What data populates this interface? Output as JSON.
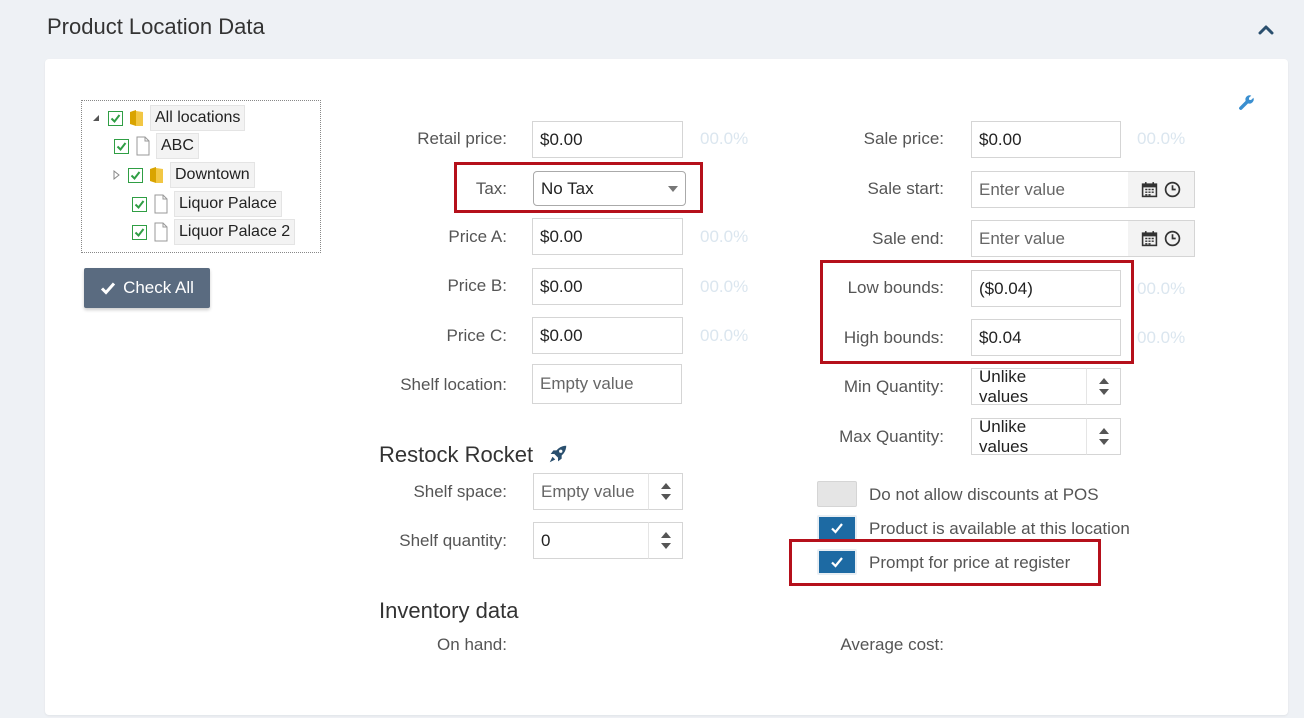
{
  "section": {
    "title": "Product Location Data"
  },
  "tree": {
    "nodes": [
      {
        "label": "All locations"
      },
      {
        "label": "ABC"
      },
      {
        "label": "Downtown"
      },
      {
        "label": "Liquor Palace"
      },
      {
        "label": "Liquor Palace 2"
      }
    ]
  },
  "check_all": {
    "label": "Check All"
  },
  "pricing": {
    "retail": {
      "label": "Retail price:",
      "value": "$0.00",
      "pct": "00.0%"
    },
    "tax": {
      "label": "Tax:",
      "value": "No Tax"
    },
    "price_a": {
      "label": "Price A:",
      "value": "$0.00",
      "pct": "00.0%"
    },
    "price_b": {
      "label": "Price B:",
      "value": "$0.00",
      "pct": "00.0%"
    },
    "price_c": {
      "label": "Price C:",
      "value": "$0.00",
      "pct": "00.0%"
    },
    "shelf_location": {
      "label": "Shelf location:",
      "placeholder": "Empty value"
    }
  },
  "sale": {
    "sale_price": {
      "label": "Sale price:",
      "value": "$0.00",
      "pct": "00.0%"
    },
    "sale_start": {
      "label": "Sale start:",
      "placeholder": "Enter value"
    },
    "sale_end": {
      "label": "Sale end:",
      "placeholder": "Enter value"
    },
    "low_bounds": {
      "label": "Low bounds:",
      "value": "($0.04)",
      "pct": "00.0%"
    },
    "high_bounds": {
      "label": "High bounds:",
      "value": "$0.04",
      "pct": "00.0%"
    },
    "min_qty": {
      "label": "Min Quantity:",
      "value": "Unlike values"
    },
    "max_qty": {
      "label": "Max Quantity:",
      "value": "Unlike values"
    }
  },
  "restock": {
    "title": "Restock Rocket",
    "shelf_space": {
      "label": "Shelf space:",
      "placeholder": "Empty value"
    },
    "shelf_quantity": {
      "label": "Shelf quantity:",
      "value": "0"
    }
  },
  "toggles": {
    "no_discounts": {
      "label": "Do not allow discounts at POS",
      "checked": false
    },
    "available": {
      "label": "Product is available at this location",
      "checked": true
    },
    "prompt_price": {
      "label": "Prompt for price at register",
      "checked": true
    }
  },
  "inventory": {
    "title": "Inventory data",
    "on_hand": {
      "label": "On hand:"
    },
    "average_cost": {
      "label": "Average cost:"
    }
  },
  "colors": {
    "highlight": "#b5101b",
    "toggle_on": "#1d6aa3",
    "button": "#5a6b80",
    "check": "#2f9e44"
  }
}
